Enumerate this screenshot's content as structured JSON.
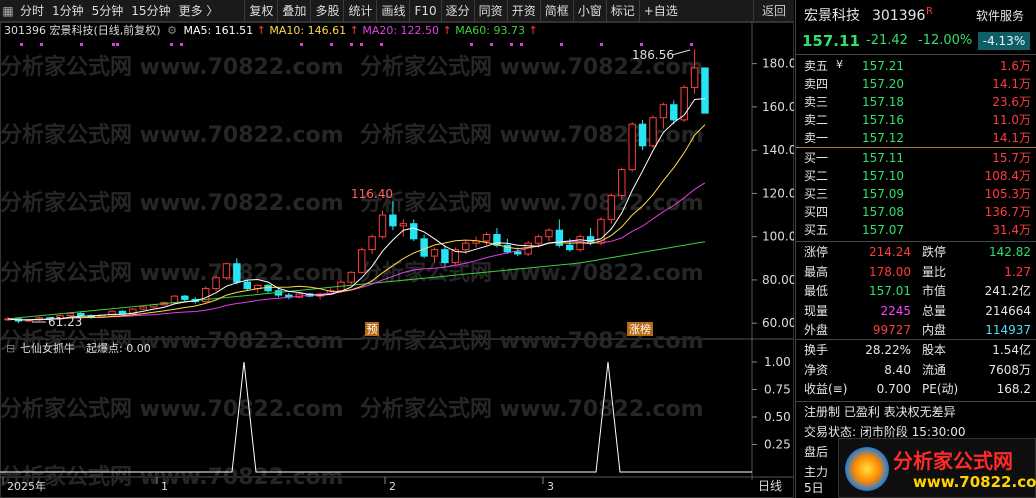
{
  "toolbar": {
    "items": [
      "分时",
      "1分钟",
      "5分钟",
      "15分钟",
      "更多 〉",
      "复权",
      "叠加",
      "多股",
      "统计",
      "画线",
      "F10",
      "逐分",
      "同资",
      "开资",
      "简框",
      "小窗",
      "标记",
      "+自选"
    ],
    "back": "返回"
  },
  "info": {
    "stock": "301396 宏景科技(日线,前复权)",
    "ma5": "MA5: 161.51",
    "ma10": "MA10: 146.61",
    "ma20": "MA20: 122.50",
    "ma60": "MA60: 93.73"
  },
  "chart_data": [
    {
      "type": "candlestick",
      "title": "301396 宏景科技(日线,前复权)",
      "y_ticks": [
        60,
        80,
        100,
        120,
        140,
        160,
        180
      ],
      "ylim": [
        55,
        190
      ],
      "x_ticks": [
        "2025年",
        "1",
        "2",
        "3"
      ],
      "annotations": {
        "high": "186.56",
        "mid_high": "116.40",
        "low": "61.23",
        "tag1": "预",
        "tag2": "涨榜"
      },
      "colors": {
        "up": "#ff3b3b",
        "down": "#27e4f4",
        "ma5": "#ffffff",
        "ma10": "#ffd84a",
        "ma20": "#e040e0",
        "ma60": "#3ccf3c"
      },
      "candles": [
        [
          62,
          63,
          61,
          62
        ],
        [
          62,
          62.5,
          60,
          61
        ],
        [
          61,
          62,
          60.5,
          61.5
        ],
        [
          61.5,
          63,
          61,
          62.5
        ],
        [
          62.5,
          63,
          61.23,
          62
        ],
        [
          62,
          64,
          61.5,
          63.5
        ],
        [
          63.5,
          65,
          63,
          64.5
        ],
        [
          64.5,
          65,
          63,
          63.5
        ],
        [
          63.5,
          64,
          62,
          63
        ],
        [
          63,
          64,
          62.5,
          63.8
        ],
        [
          63.8,
          66,
          63.5,
          65.5
        ],
        [
          65.5,
          66,
          64,
          64.5
        ],
        [
          64.5,
          67,
          64,
          66.5
        ],
        [
          66.5,
          68,
          66,
          67.5
        ],
        [
          67.5,
          69,
          67,
          68.5
        ],
        [
          68.5,
          70,
          68,
          69.5
        ],
        [
          69.5,
          73,
          69,
          72.5
        ],
        [
          72.5,
          73,
          70,
          71
        ],
        [
          71,
          72,
          69,
          70
        ],
        [
          70,
          77,
          69.5,
          76
        ],
        [
          76,
          82,
          75,
          81
        ],
        [
          81,
          88,
          80,
          87.5
        ],
        [
          87.5,
          90,
          78,
          79
        ],
        [
          79,
          80,
          75,
          76
        ],
        [
          76,
          78,
          74,
          77.5
        ],
        [
          77.5,
          78,
          74,
          75
        ],
        [
          75,
          76,
          72,
          73
        ],
        [
          73,
          74,
          71,
          72
        ],
        [
          72,
          74,
          71.5,
          73.5
        ],
        [
          73.5,
          74,
          72,
          72.5
        ],
        [
          72.5,
          74,
          71,
          73.5
        ],
        [
          73.5,
          76,
          73,
          75
        ],
        [
          75,
          80,
          74,
          79
        ],
        [
          79,
          84,
          78,
          83.5
        ],
        [
          83.5,
          95,
          83,
          94
        ],
        [
          94,
          101,
          92,
          100
        ],
        [
          100,
          112,
          99,
          110
        ],
        [
          110,
          116.4,
          103,
          105
        ],
        [
          105,
          108,
          100,
          106
        ],
        [
          106,
          108,
          98,
          99
        ],
        [
          99,
          101,
          90,
          91
        ],
        [
          91,
          95,
          88,
          94
        ],
        [
          94,
          96,
          86,
          88
        ],
        [
          88,
          95,
          87,
          94
        ],
        [
          94,
          98,
          92,
          97
        ],
        [
          97,
          100,
          95,
          98
        ],
        [
          98,
          102,
          96,
          101
        ],
        [
          101,
          104,
          95,
          96
        ],
        [
          96,
          99,
          92,
          93
        ],
        [
          93,
          95,
          91,
          92
        ],
        [
          92,
          98,
          91,
          97
        ],
        [
          97,
          101,
          95,
          100
        ],
        [
          100,
          104,
          98,
          103
        ],
        [
          103,
          108,
          95,
          96
        ],
        [
          96,
          99,
          93,
          94
        ],
        [
          94,
          101,
          93,
          100
        ],
        [
          100,
          104,
          96,
          97
        ],
        [
          97,
          109,
          96,
          108
        ],
        [
          108,
          120,
          106,
          119
        ],
        [
          119,
          132,
          117,
          131
        ],
        [
          131,
          153,
          130,
          152
        ],
        [
          152,
          154,
          140,
          142
        ],
        [
          142,
          156,
          141,
          155
        ],
        [
          155,
          162,
          150,
          161
        ],
        [
          161,
          163,
          152,
          154
        ],
        [
          154,
          170,
          153,
          169
        ],
        [
          169,
          186.56,
          166,
          178
        ],
        [
          178,
          178,
          157.01,
          157.11
        ]
      ]
    },
    {
      "type": "line",
      "title": "七仙女抓牛",
      "series": [
        {
          "name": "起爆点",
          "value_label": "起爆点: 0.00",
          "spikes_at_index": [
            20,
            50
          ],
          "values_range": [
            0,
            1
          ]
        }
      ],
      "y_ticks": [
        "1.00",
        "0.75",
        "0.50",
        "0.25"
      ]
    }
  ],
  "bottom": {
    "label": "日线"
  },
  "rp": {
    "name": "宏景科技",
    "code": "301396",
    "flag": "R",
    "price": "157.11",
    "chg": "-21.42",
    "pct": "-12.00%",
    "svc": "软件服务",
    "svc_pct": "-4.13%",
    "asks": [
      {
        "l": "卖五",
        "p": "157.21",
        "v": "1.6万"
      },
      {
        "l": "卖四",
        "p": "157.20",
        "v": "14.1万"
      },
      {
        "l": "卖三",
        "p": "157.18",
        "v": "23.6万"
      },
      {
        "l": "卖二",
        "p": "157.16",
        "v": "11.0万"
      },
      {
        "l": "卖一",
        "p": "157.12",
        "v": "14.1万"
      }
    ],
    "ask_sym": "¥",
    "bids": [
      {
        "l": "买一",
        "p": "157.11",
        "v": "15.7万"
      },
      {
        "l": "买二",
        "p": "157.10",
        "v": "108.4万"
      },
      {
        "l": "买三",
        "p": "157.09",
        "v": "105.3万"
      },
      {
        "l": "买四",
        "p": "157.08",
        "v": "136.7万"
      },
      {
        "l": "买五",
        "p": "157.07",
        "v": "31.4万"
      }
    ],
    "stats": [
      {
        "a": "涨停",
        "av": "214.24",
        "b": "跌停",
        "bv": "142.82"
      },
      {
        "a": "最高",
        "av": "178.00",
        "b": "量比",
        "bv": "1.27"
      },
      {
        "a": "最低",
        "av": "157.01",
        "b": "市值",
        "bv": "241.2亿"
      },
      {
        "a": "现量",
        "av": "2245",
        "b": "总量",
        "bv": "214664"
      },
      {
        "a": "外盘",
        "av": "99727",
        "b": "内盘",
        "bv": "114937"
      }
    ],
    "stats2": [
      {
        "a": "换手",
        "av": "28.22%",
        "b": "股本",
        "bv": "1.54亿"
      },
      {
        "a": "净资",
        "av": "8.40",
        "b": "流通",
        "bv": "7608万"
      },
      {
        "a": "收益(≡)",
        "av": "0.700",
        "b": "PE(动)",
        "bv": "168.2"
      }
    ],
    "note1": "注册制 已盈利 表决权无差异",
    "note2": "交易状态: 闭市阶段 15:30:00",
    "note3": "盘后",
    "note4": "主力",
    "note5": "5日"
  },
  "watermark": {
    "text": "分析家公式网 www.70822.com",
    "logo1": "分析家公式网",
    "logo2": "www.70822.com"
  }
}
